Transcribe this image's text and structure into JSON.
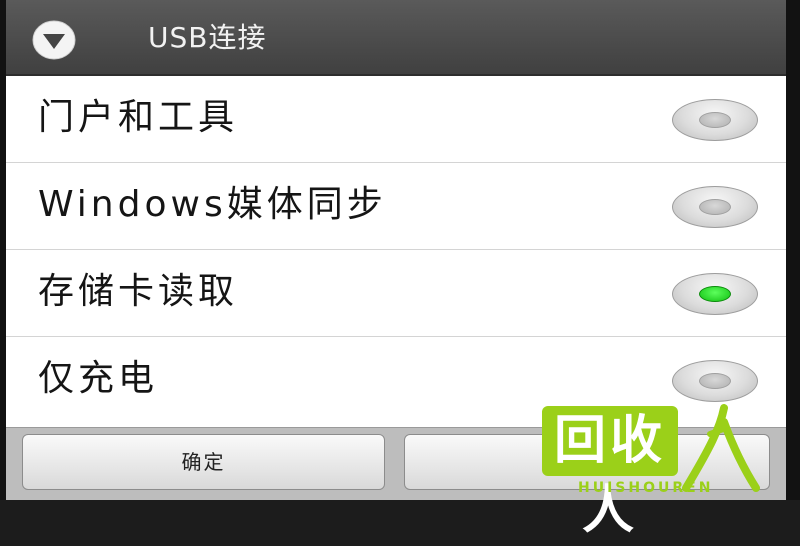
{
  "dialog": {
    "title": "USB连接",
    "title_icon": "usb-dropdown-circle-icon"
  },
  "options": [
    {
      "label": "门户和工具",
      "checked": false
    },
    {
      "label": "Windows媒体同步",
      "checked": false
    },
    {
      "label": "存储卡读取",
      "checked": true
    },
    {
      "label": "仅充电",
      "checked": false
    }
  ],
  "buttons": {
    "ok_label": "确定",
    "cancel_label": ""
  },
  "watermark": {
    "logo_text": "回收人",
    "roman_text": "HUISHOUREN"
  },
  "colors": {
    "title_bar": "#4a4a4a",
    "selected_radio": "#22dd22",
    "watermark_green": "#9bd019"
  }
}
